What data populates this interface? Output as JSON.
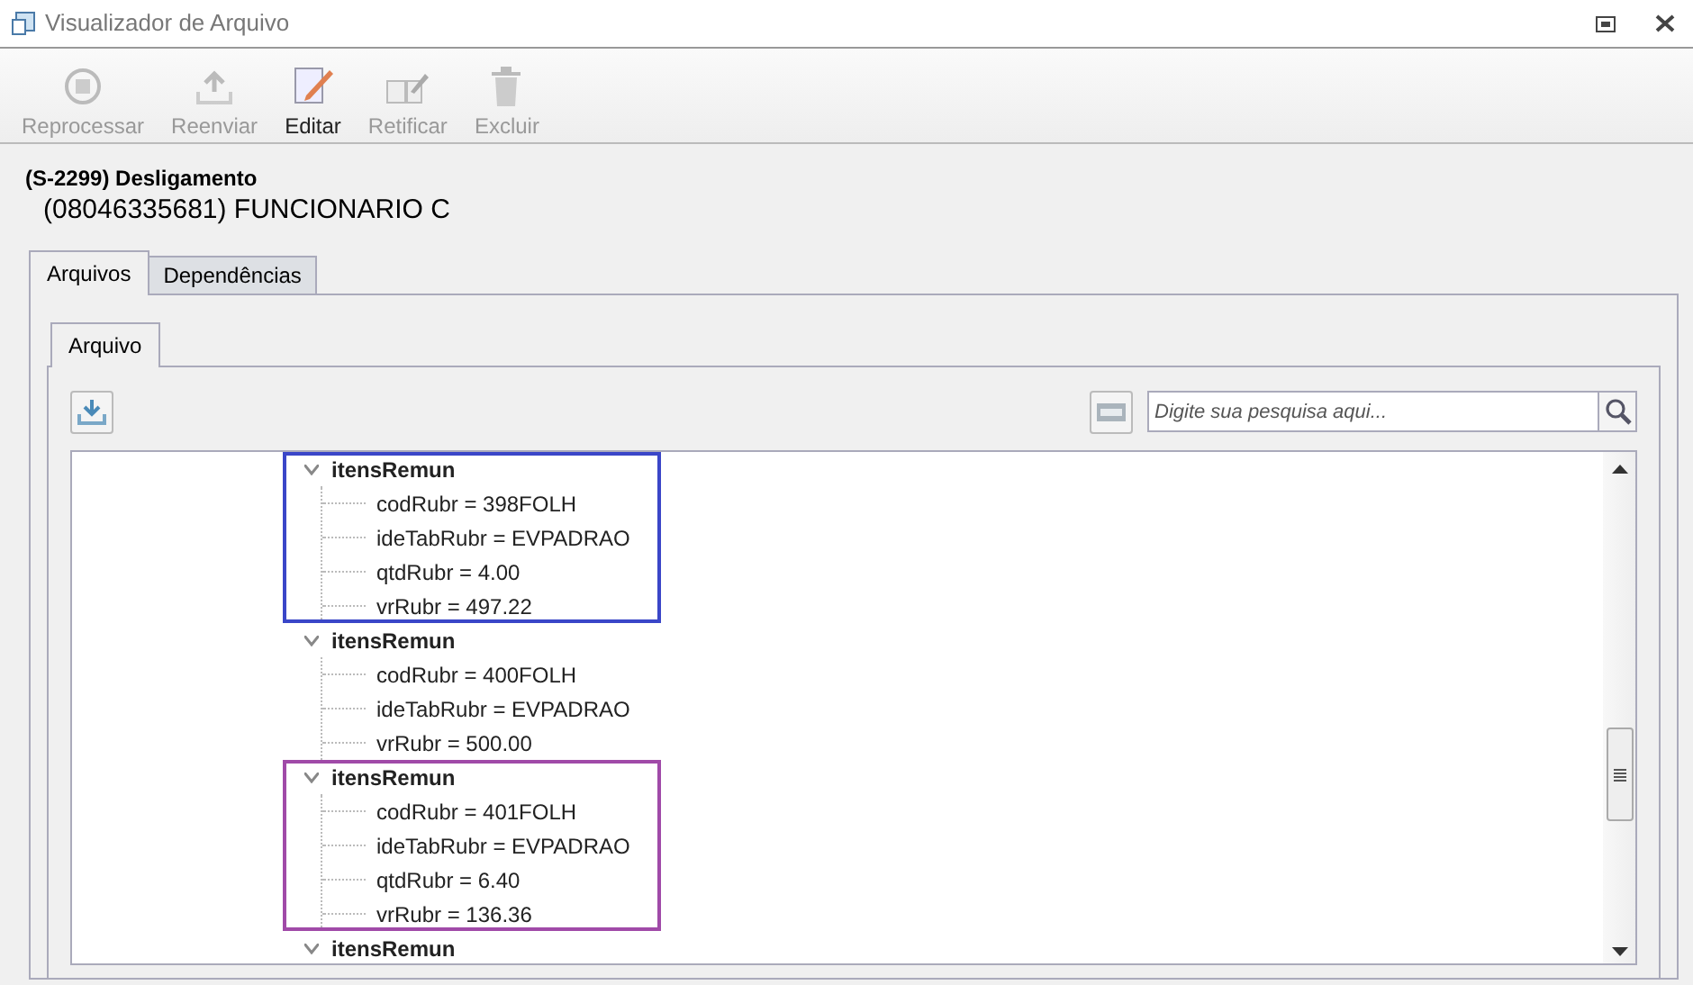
{
  "window": {
    "title": "Visualizador de Arquivo"
  },
  "toolbar": [
    {
      "label": "Reprocessar",
      "disabled": true
    },
    {
      "label": "Reenviar",
      "disabled": true
    },
    {
      "label": "Editar",
      "disabled": false
    },
    {
      "label": "Retificar",
      "disabled": true
    },
    {
      "label": "Excluir",
      "disabled": true
    }
  ],
  "header": {
    "title": "(S-2299) Desligamento",
    "subtitle": "(08046335681) FUNCIONARIO C"
  },
  "tabs": [
    {
      "label": "Arquivos",
      "selected": true
    },
    {
      "label": "Dependências",
      "selected": false
    }
  ],
  "inner_tabs": [
    {
      "label": "Arquivo",
      "selected": true
    }
  ],
  "search": {
    "placeholder": "Digite sua pesquisa aqui..."
  },
  "tree": [
    {
      "label": "itensRemun",
      "expanded": true,
      "color": "#3a46c8",
      "children": [
        {
          "label": "codRubr = 398FOLH"
        },
        {
          "label": "ideTabRubr = EVPADRAO"
        },
        {
          "label": "qtdRubr = 4.00"
        },
        {
          "label": "vrRubr = 497.22"
        }
      ]
    },
    {
      "label": "itensRemun",
      "expanded": true,
      "children": [
        {
          "label": "codRubr = 400FOLH"
        },
        {
          "label": "ideTabRubr = EVPADRAO"
        },
        {
          "label": "vrRubr = 500.00"
        }
      ]
    },
    {
      "label": "itensRemun",
      "expanded": true,
      "color": "#a04aa8",
      "children": [
        {
          "label": "codRubr = 401FOLH"
        },
        {
          "label": "ideTabRubr = EVPADRAO"
        },
        {
          "label": "qtdRubr = 6.40"
        },
        {
          "label": "vrRubr = 136.36"
        }
      ]
    },
    {
      "label": "itensRemun",
      "expanded": true
    }
  ]
}
